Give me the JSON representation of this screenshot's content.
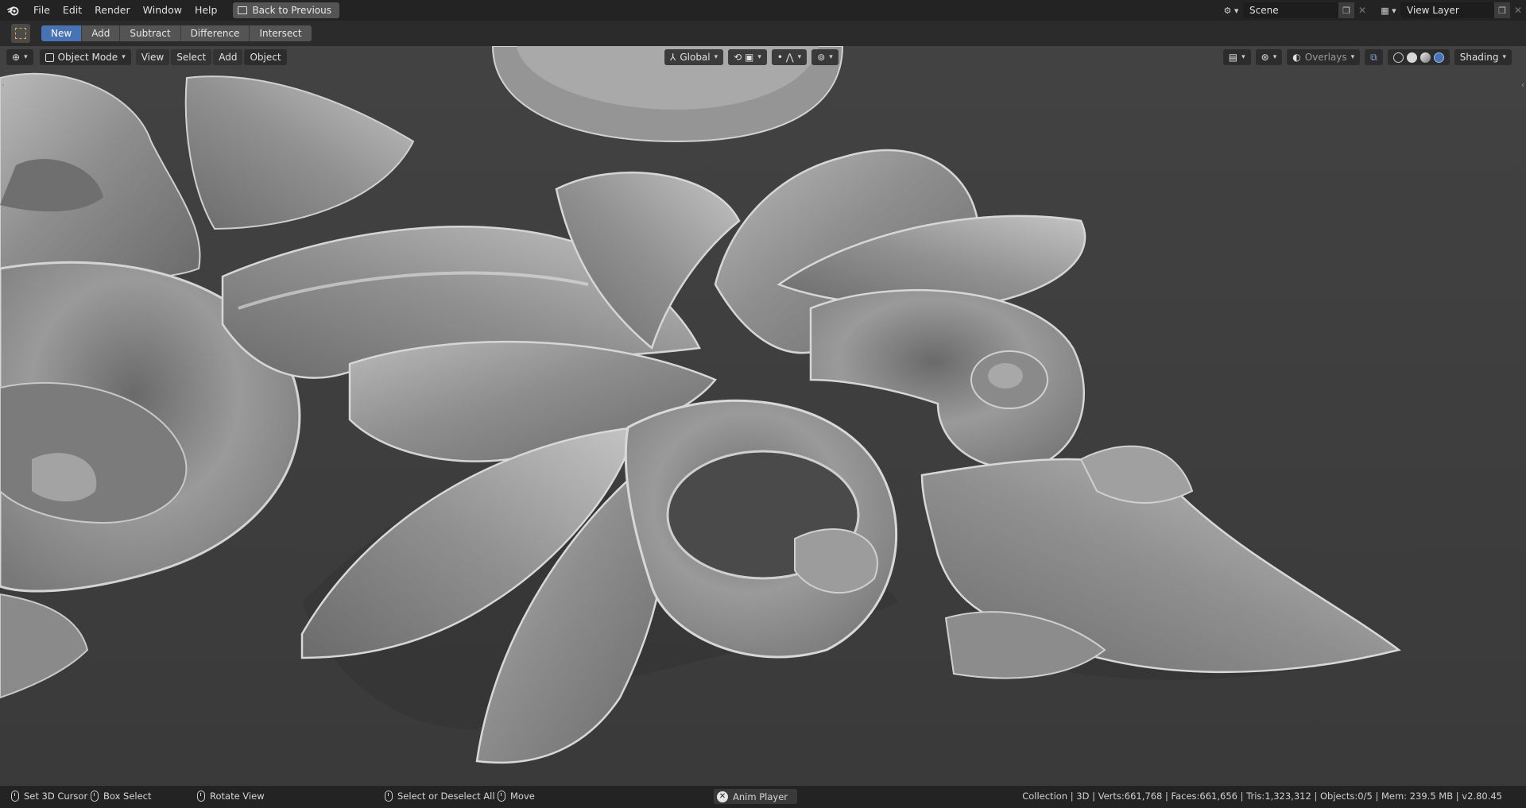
{
  "topbar": {
    "menu": [
      "File",
      "Edit",
      "Render",
      "Window",
      "Help"
    ],
    "back_label": "Back to Previous",
    "scene_value": "Scene",
    "view_layer_value": "View Layer"
  },
  "toolheader": {
    "modes": [
      "New",
      "Add",
      "Subtract",
      "Difference",
      "Intersect"
    ],
    "active_mode": "New"
  },
  "viewport": {
    "mode": "Object Mode",
    "menus": [
      "View",
      "Select",
      "Add",
      "Object"
    ],
    "orientation": "Global",
    "overlays_label": "Overlays",
    "shading_label": "Shading"
  },
  "statusbar": {
    "set_cursor": "Set 3D Cursor",
    "box_select": "Box Select",
    "rotate_view": "Rotate View",
    "select_deselect": "Select or Deselect All",
    "move": "Move",
    "anim_player": "Anim Player",
    "stats": "Collection | 3D | Verts:661,768 | Faces:661,656 | Tris:1,323,312 | Objects:0/5 | Mem: 239.5 MB | v2.80.45"
  },
  "colors": {
    "accent": "#4772b3",
    "background": "#3e3e3e",
    "header": "#232323",
    "tool_dashed": "#e9a23a"
  }
}
